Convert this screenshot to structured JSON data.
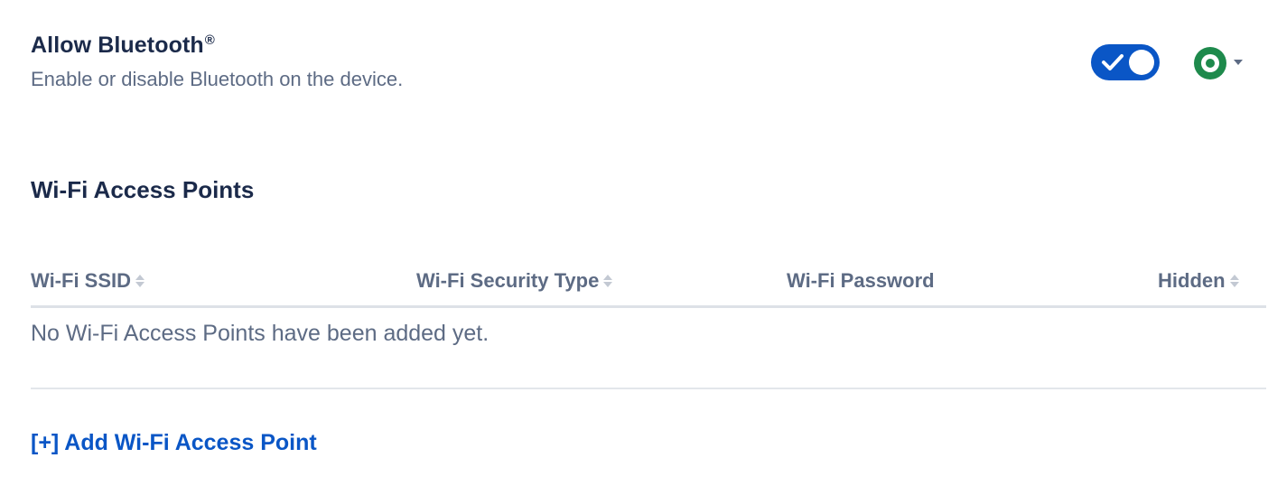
{
  "bluetooth_setting": {
    "title": "Allow Bluetooth",
    "title_mark": "®",
    "description": "Enable or disable Bluetooth on the device.",
    "toggle_state": "on",
    "toggle_color": "#0a56c6",
    "status_color": "#1e8a4c"
  },
  "wifi_section": {
    "title": "Wi-Fi Access Points",
    "columns": [
      {
        "label": "Wi-Fi SSID",
        "sortable": true
      },
      {
        "label": "Wi-Fi Security Type",
        "sortable": true
      },
      {
        "label": "Wi-Fi Password",
        "sortable": false
      },
      {
        "label": "Hidden",
        "sortable": true
      }
    ],
    "empty_message": "No Wi-Fi Access Points have been added yet.",
    "add_link_label": "[+] Add Wi-Fi Access Point"
  },
  "icons": {
    "toggle": "checkmark-icon",
    "status": "status-ring-icon",
    "caret": "caret-down-icon",
    "sort": "sort-arrows-icon"
  }
}
